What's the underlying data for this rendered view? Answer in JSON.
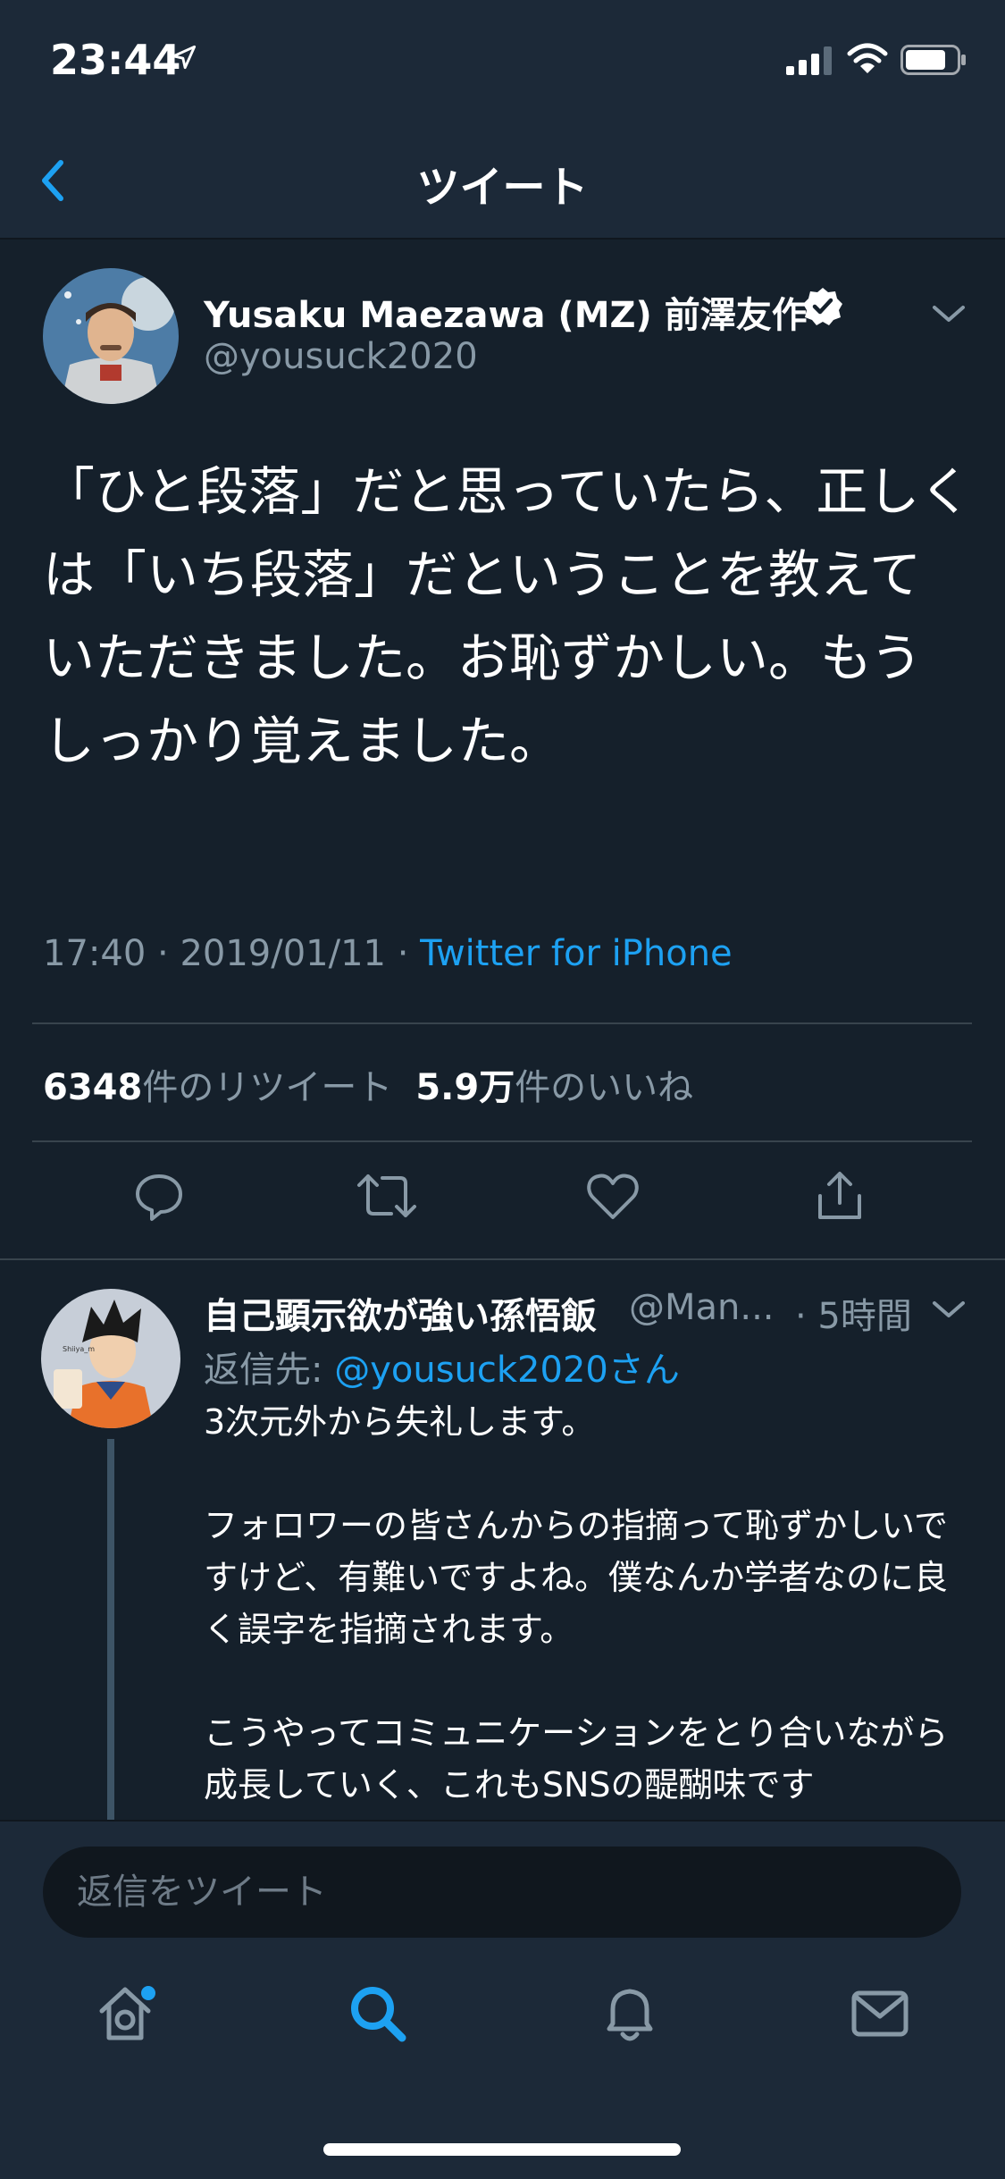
{
  "status_bar": {
    "time": "23:44"
  },
  "nav": {
    "title": "ツイート"
  },
  "tweet": {
    "author_name": "Yusaku Maezawa (MZ) 前澤友作",
    "handle": "@yousuck2020",
    "text": "「ひと段落」だと思っていたら、正しくは「いち段落」だということを教えていただきました。お恥ずかしい。もうしっかり覚えました。",
    "time": "17:40",
    "date": "2019/01/11",
    "separator": " · ",
    "source": "Twitter for iPhone",
    "retweet_count": "6348",
    "retweet_label": "件のリツイート",
    "like_count": "5.9万",
    "like_label": "件のいいね"
  },
  "reply": {
    "author_name": "自己顕示欲が強い孫悟飯",
    "handle": "@Man...",
    "time": "· 5時間",
    "reply_to_prefix": "返信先: ",
    "reply_to_target": "@yousuck2020さん",
    "text": "3次元外から失礼します。\n\nフォロワーの皆さんからの指摘って恥ずかしいですけど、有難いですよね。僕なんか学者なのに良く誤字を指摘されます。\n\nこうやってコミュニケーションをとり合いながら成長していく、これもSNSの醍醐味です"
  },
  "composer": {
    "placeholder": "返信をツイート"
  },
  "colors": {
    "background": "#15202b",
    "bar": "#1c2938",
    "accent": "#1da1f2",
    "secondary_text": "#8899a6",
    "divider": "#38444d"
  },
  "icons": {
    "status": [
      "location-arrow-icon",
      "signal-icon",
      "wifi-icon",
      "battery-icon"
    ],
    "actions": [
      "reply-icon",
      "retweet-icon",
      "like-icon",
      "share-icon"
    ],
    "tabs": [
      "home-icon",
      "search-icon",
      "notifications-icon",
      "messages-icon"
    ]
  }
}
